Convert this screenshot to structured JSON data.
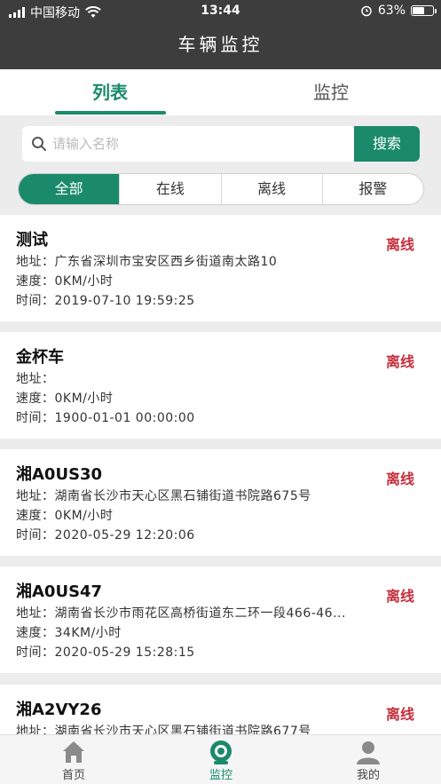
{
  "status_bar": {
    "carrier": "中国移动",
    "time": "13:44",
    "battery_percent": "63%",
    "battery_level": 0.63,
    "icons": [
      "signal-icon",
      "wifi-icon",
      "alarm-icon",
      "battery-icon"
    ]
  },
  "header": {
    "title": "车辆监控"
  },
  "tabs": [
    {
      "label": "列表",
      "active": true
    },
    {
      "label": "监控",
      "active": false
    }
  ],
  "search": {
    "placeholder": "请输入名称",
    "value": "",
    "button_label": "搜索"
  },
  "filters": [
    {
      "label": "全部",
      "active": true
    },
    {
      "label": "在线",
      "active": false
    },
    {
      "label": "离线",
      "active": false
    },
    {
      "label": "报警",
      "active": false
    }
  ],
  "vehicles": [
    {
      "name": "测试",
      "status": "离线",
      "address": "地址：广东省深圳市宝安区西乡街道南太路10",
      "speed": "速度：0KM/小时",
      "time": "时间：2019-07-10 19:59:25"
    },
    {
      "name": "金杯车",
      "status": "离线",
      "address": "地址：",
      "speed": "速度：0KM/小时",
      "time": "时间：1900-01-01 00:00:00"
    },
    {
      "name": "湘A0US30",
      "status": "离线",
      "address": "地址：湖南省长沙市天心区黑石铺街道书院路675号",
      "speed": "速度：0KM/小时",
      "time": "时间：2020-05-29 12:20:06"
    },
    {
      "name": "湘A0US47",
      "status": "离线",
      "address": "地址：湖南省长沙市雨花区高桥街道东二环一段466-46...",
      "speed": "速度：34KM/小时",
      "time": "时间：2020-05-29 15:28:15"
    },
    {
      "name": "湘A2VY26",
      "status": "离线",
      "address": "地址：湖南省长沙市天心区黑石铺街道书院路677号",
      "speed": "",
      "time": ""
    }
  ],
  "bottom_nav": [
    {
      "label": "首页",
      "icon": "home-icon",
      "active": false
    },
    {
      "label": "监控",
      "icon": "monitor-camera-icon",
      "active": true
    },
    {
      "label": "我的",
      "icon": "user-icon",
      "active": false
    }
  ],
  "colors": {
    "primary": "#1a8a6a",
    "header_bg": "#3d3d3d",
    "offline_red": "#c62f3d",
    "page_bg": "#ececec"
  }
}
